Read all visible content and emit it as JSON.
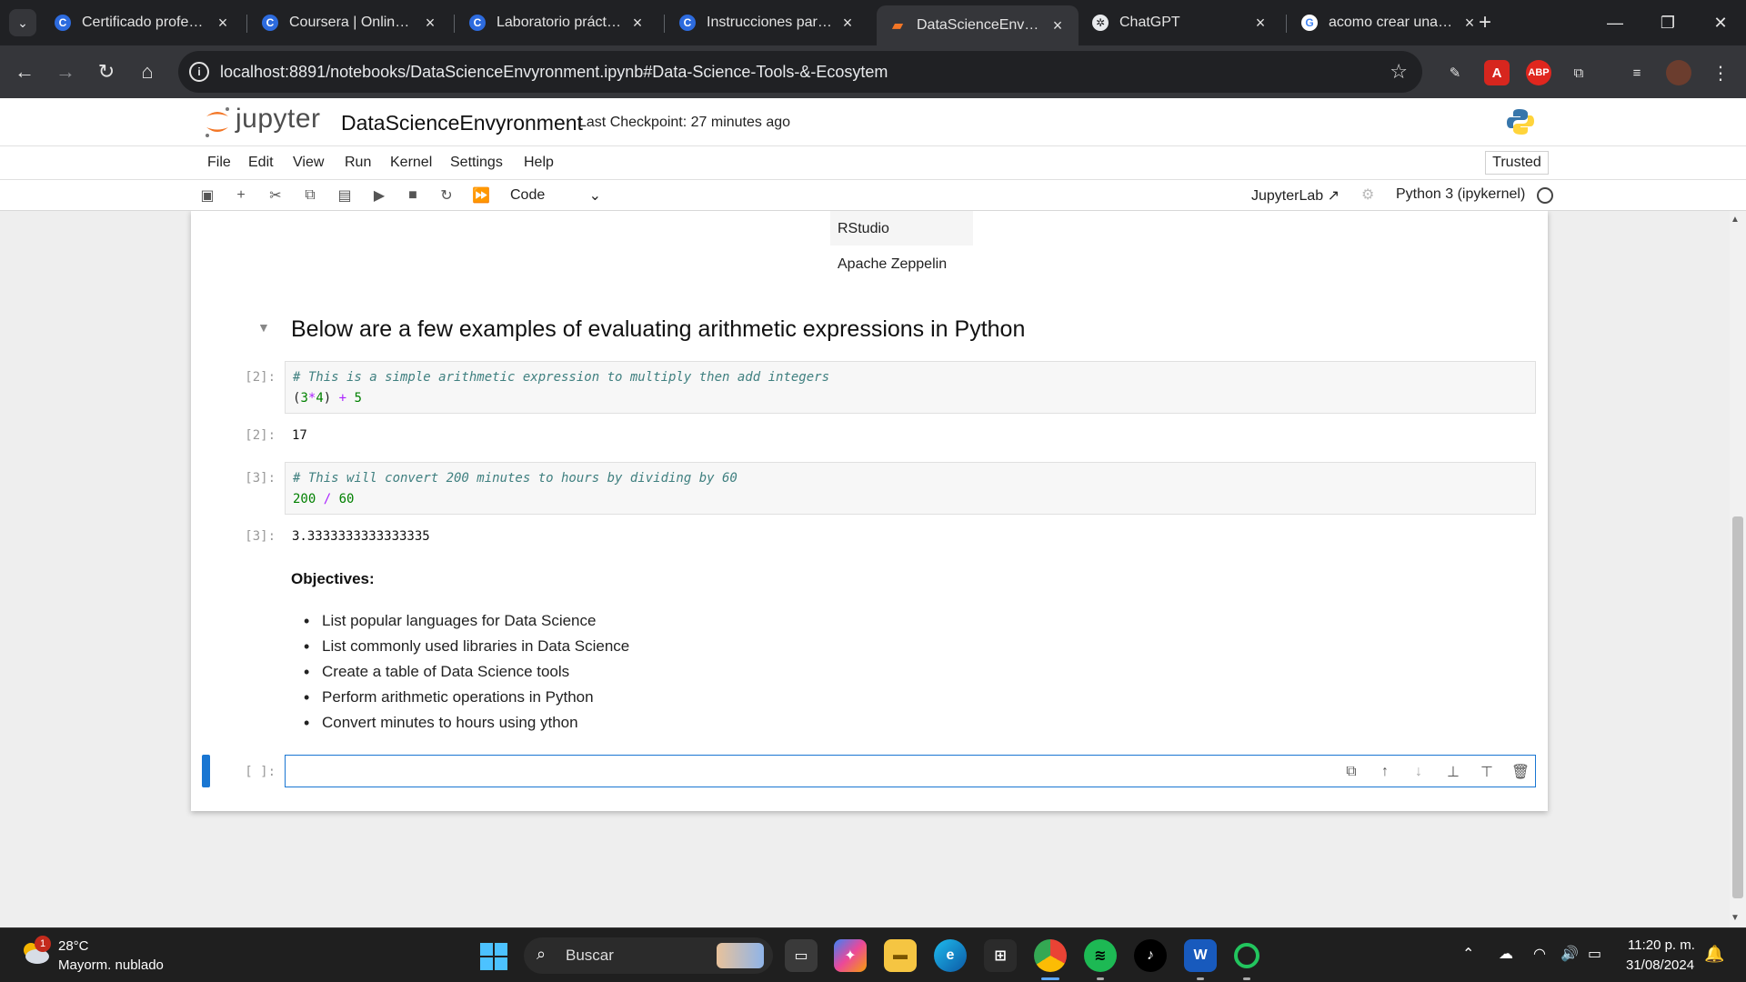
{
  "browser": {
    "tabs": [
      {
        "label": "Certificado profesion",
        "icon": "coursera-icon"
      },
      {
        "label": "Coursera | Online Co",
        "icon": "coursera-icon"
      },
      {
        "label": "Laboratorio práctico:",
        "icon": "coursera-icon"
      },
      {
        "label": "Instrucciones para la",
        "icon": "coursera-icon"
      },
      {
        "label": "DataScienceEnvyronn",
        "icon": "jupyter-icon"
      },
      {
        "label": "ChatGPT",
        "icon": "chatgpt-icon"
      },
      {
        "label": "acomo crear una line",
        "icon": "google-icon"
      }
    ],
    "active_tab": 4,
    "url": "localhost:8891/notebooks/DataScienceEnvyronment.ipynb#Data-Science-Tools-&-Ecosytem",
    "tab_accent": "#35363a"
  },
  "jupyter": {
    "logo_text": "jupyter",
    "notebook_name": "DataScienceEnvyronment",
    "checkpoint": "Last Checkpoint: 27 minutes ago",
    "menu": [
      "File",
      "Edit",
      "View",
      "Run",
      "Kernel",
      "Settings",
      "Help"
    ],
    "trusted": "Trusted",
    "cell_type": "Code",
    "jupyterlab_link": "JupyterLab",
    "kernel": "Python 3 (ipykernel)",
    "accent_color": "#1976d2"
  },
  "notebook": {
    "table_rows": [
      "RStudio",
      "Apache Zeppelin"
    ],
    "heading": "Below are a few examples of evaluating arithmetic expressions in Python",
    "cells": [
      {
        "in_prompt": "[2]:",
        "comment": "# This is a simple arithmetic expression to multiply then add integers",
        "code": {
          "open": "(",
          "a": "3",
          "mul": "*",
          "b": "4",
          "close": ")",
          "plus": "+",
          "c": "5"
        },
        "out_prompt": "[2]:",
        "output": "17"
      },
      {
        "in_prompt": "[3]:",
        "comment": "# This will convert 200 minutes to hours by dividing by 60",
        "code": {
          "a": "200",
          "div": "/",
          "b": "60"
        },
        "out_prompt": "[3]:",
        "output": "3.3333333333333335"
      }
    ],
    "objectives_title": "Objectives:",
    "objectives": [
      "List popular languages for Data Science",
      "List commonly used libraries in Data Science",
      "Create a table of Data Science tools",
      "Perform arithmetic operations in Python",
      "Convert minutes to hours using ython"
    ],
    "empty_prompt": "[ ]:"
  },
  "taskbar": {
    "weather_badge": "1",
    "temperature": "28°C",
    "weather": "Mayorm. nublado",
    "search": "Buscar",
    "time": "11:20 p. m.",
    "date": "31/08/2024"
  }
}
